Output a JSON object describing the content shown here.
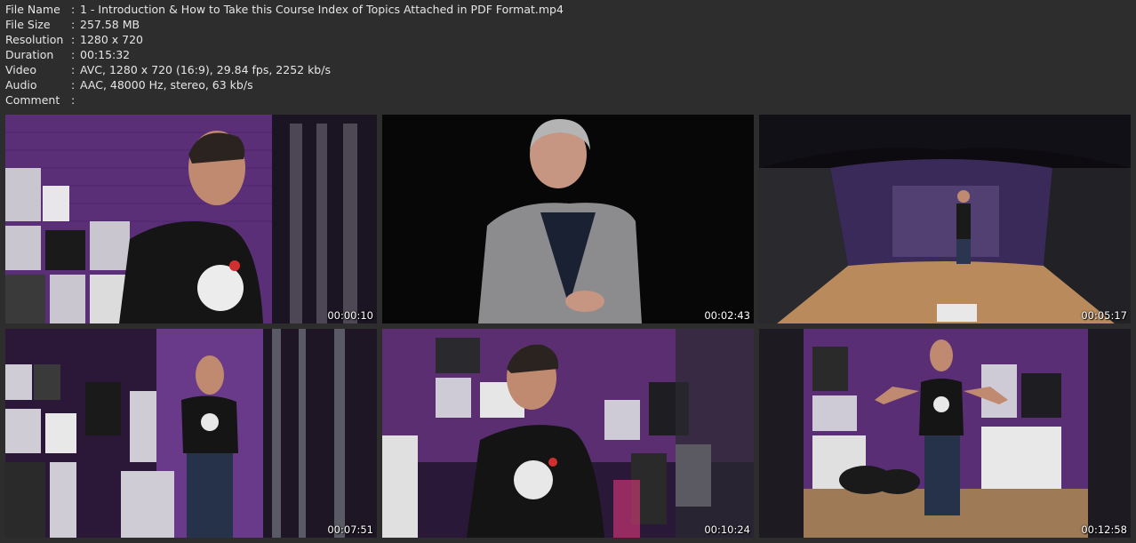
{
  "info": {
    "rows": [
      {
        "label": "File Name",
        "value": "1 - Introduction & How to Take this Course Index of Topics Attached in PDF Format.mp4"
      },
      {
        "label": "File Size",
        "value": "257.58 MB"
      },
      {
        "label": "Resolution",
        "value": "1280 x 720"
      },
      {
        "label": "Duration",
        "value": "00:15:32"
      },
      {
        "label": "Video",
        "value": "AVC, 1280 x 720 (16:9), 29.84 fps, 2252 kb/s"
      },
      {
        "label": "Audio",
        "value": "AAC, 48000 Hz, stereo, 63 kb/s"
      },
      {
        "label": "Comment",
        "value": ""
      }
    ],
    "separator": ":"
  },
  "thumbnails": [
    {
      "timestamp": "00:00:10"
    },
    {
      "timestamp": "00:02:43"
    },
    {
      "timestamp": "00:05:17"
    },
    {
      "timestamp": "00:07:51"
    },
    {
      "timestamp": "00:10:24"
    },
    {
      "timestamp": "00:12:58"
    }
  ]
}
